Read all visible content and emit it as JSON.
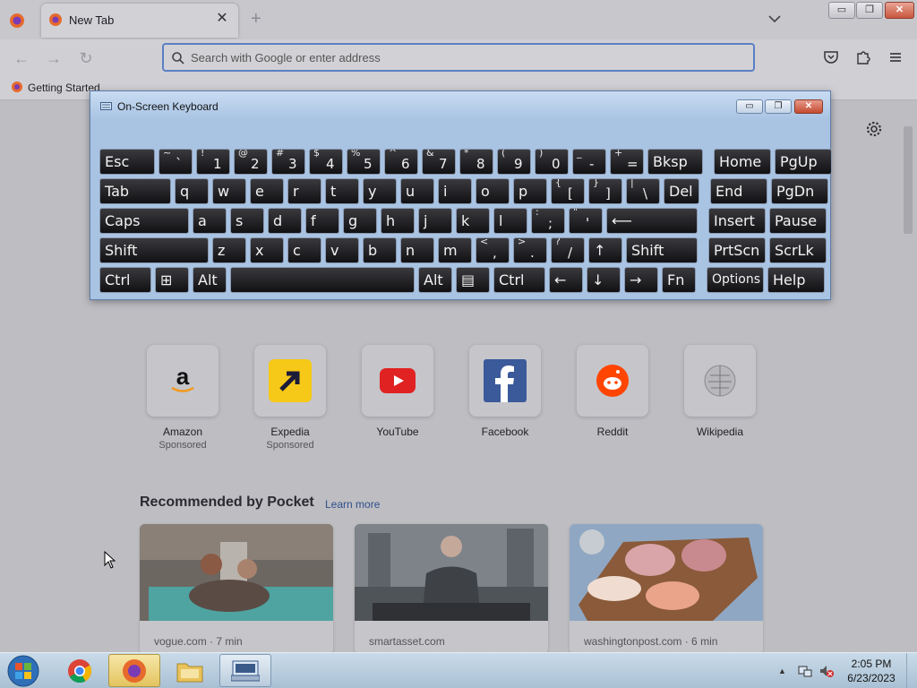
{
  "browser": {
    "tab_title": "New Tab",
    "tab_close": "✕",
    "new_tab": "+",
    "url_placeholder": "Search with Google or enter address",
    "bookmark": "Getting Started"
  },
  "window_controls": {
    "minimize": "▭",
    "maximize": "❐",
    "close": "✕"
  },
  "osk": {
    "title": "On-Screen Keyboard",
    "rows": [
      [
        {
          "l": "Esc"
        },
        {
          "s": "~",
          "m": "`"
        },
        {
          "s": "!",
          "m": "1"
        },
        {
          "s": "@",
          "m": "2"
        },
        {
          "s": "#",
          "m": "3"
        },
        {
          "s": "$",
          "m": "4"
        },
        {
          "s": "%",
          "m": "5"
        },
        {
          "s": "^",
          "m": "6"
        },
        {
          "s": "&",
          "m": "7"
        },
        {
          "s": "*",
          "m": "8"
        },
        {
          "s": "(",
          "m": "9"
        },
        {
          "s": ")",
          "m": "0"
        },
        {
          "s": "_",
          "m": "-"
        },
        {
          "s": "+",
          "m": "="
        },
        {
          "l": "Bksp"
        },
        {
          "l": "Home"
        },
        {
          "l": "PgUp"
        }
      ],
      [
        {
          "l": "Tab"
        },
        {
          "l": "q"
        },
        {
          "l": "w"
        },
        {
          "l": "e"
        },
        {
          "l": "r"
        },
        {
          "l": "t"
        },
        {
          "l": "y"
        },
        {
          "l": "u"
        },
        {
          "l": "i"
        },
        {
          "l": "o"
        },
        {
          "l": "p"
        },
        {
          "s": "{",
          "m": "["
        },
        {
          "s": "}",
          "m": "]"
        },
        {
          "s": "|",
          "m": "\\"
        },
        {
          "l": "Del"
        },
        {
          "l": "End"
        },
        {
          "l": "PgDn"
        }
      ],
      [
        {
          "l": "Caps"
        },
        {
          "l": "a"
        },
        {
          "l": "s"
        },
        {
          "l": "d"
        },
        {
          "l": "f"
        },
        {
          "l": "g"
        },
        {
          "l": "h"
        },
        {
          "l": "j"
        },
        {
          "l": "k"
        },
        {
          "l": "l"
        },
        {
          "s": ":",
          "m": ";"
        },
        {
          "s": "\"",
          "m": "'"
        },
        {
          "l": "⟵"
        },
        {
          "l": "Insert"
        },
        {
          "l": "Pause"
        }
      ],
      [
        {
          "l": "Shift"
        },
        {
          "l": "z"
        },
        {
          "l": "x"
        },
        {
          "l": "c"
        },
        {
          "l": "v"
        },
        {
          "l": "b"
        },
        {
          "l": "n"
        },
        {
          "l": "m"
        },
        {
          "s": "<",
          "m": ","
        },
        {
          "s": ">",
          "m": "."
        },
        {
          "s": "?",
          "m": "/"
        },
        {
          "l": "↑"
        },
        {
          "l": "Shift"
        },
        {
          "l": "PrtScn"
        },
        {
          "l": "ScrLk"
        }
      ],
      [
        {
          "l": "Ctrl"
        },
        {
          "l": "⊞"
        },
        {
          "l": "Alt"
        },
        {
          "l": ""
        },
        {
          "l": "Alt"
        },
        {
          "l": "▤"
        },
        {
          "l": "Ctrl"
        },
        {
          "l": "←"
        },
        {
          "l": "↓"
        },
        {
          "l": "→"
        },
        {
          "l": "Fn"
        },
        {
          "l": "Options"
        },
        {
          "l": "Help"
        }
      ]
    ]
  },
  "shortcuts": [
    {
      "label": "Amazon",
      "sponsored": "Sponsored"
    },
    {
      "label": "Expedia",
      "sponsored": "Sponsored"
    },
    {
      "label": "YouTube",
      "sponsored": ""
    },
    {
      "label": "Facebook",
      "sponsored": ""
    },
    {
      "label": "Reddit",
      "sponsored": ""
    },
    {
      "label": "Wikipedia",
      "sponsored": ""
    }
  ],
  "pocket": {
    "heading": "Recommended by Pocket",
    "learn_more": "Learn more",
    "cards": [
      {
        "source": "vogue.com · 7 min"
      },
      {
        "source": "smartasset.com"
      },
      {
        "source": "washingtonpost.com · 6 min"
      }
    ]
  },
  "taskbar": {
    "time": "2:05 PM",
    "date": "6/23/2023"
  },
  "colors": {
    "accent": "#5a7fc4",
    "pocket_link": "#2f4f8c",
    "taskbar_active": "#e3c45f"
  }
}
